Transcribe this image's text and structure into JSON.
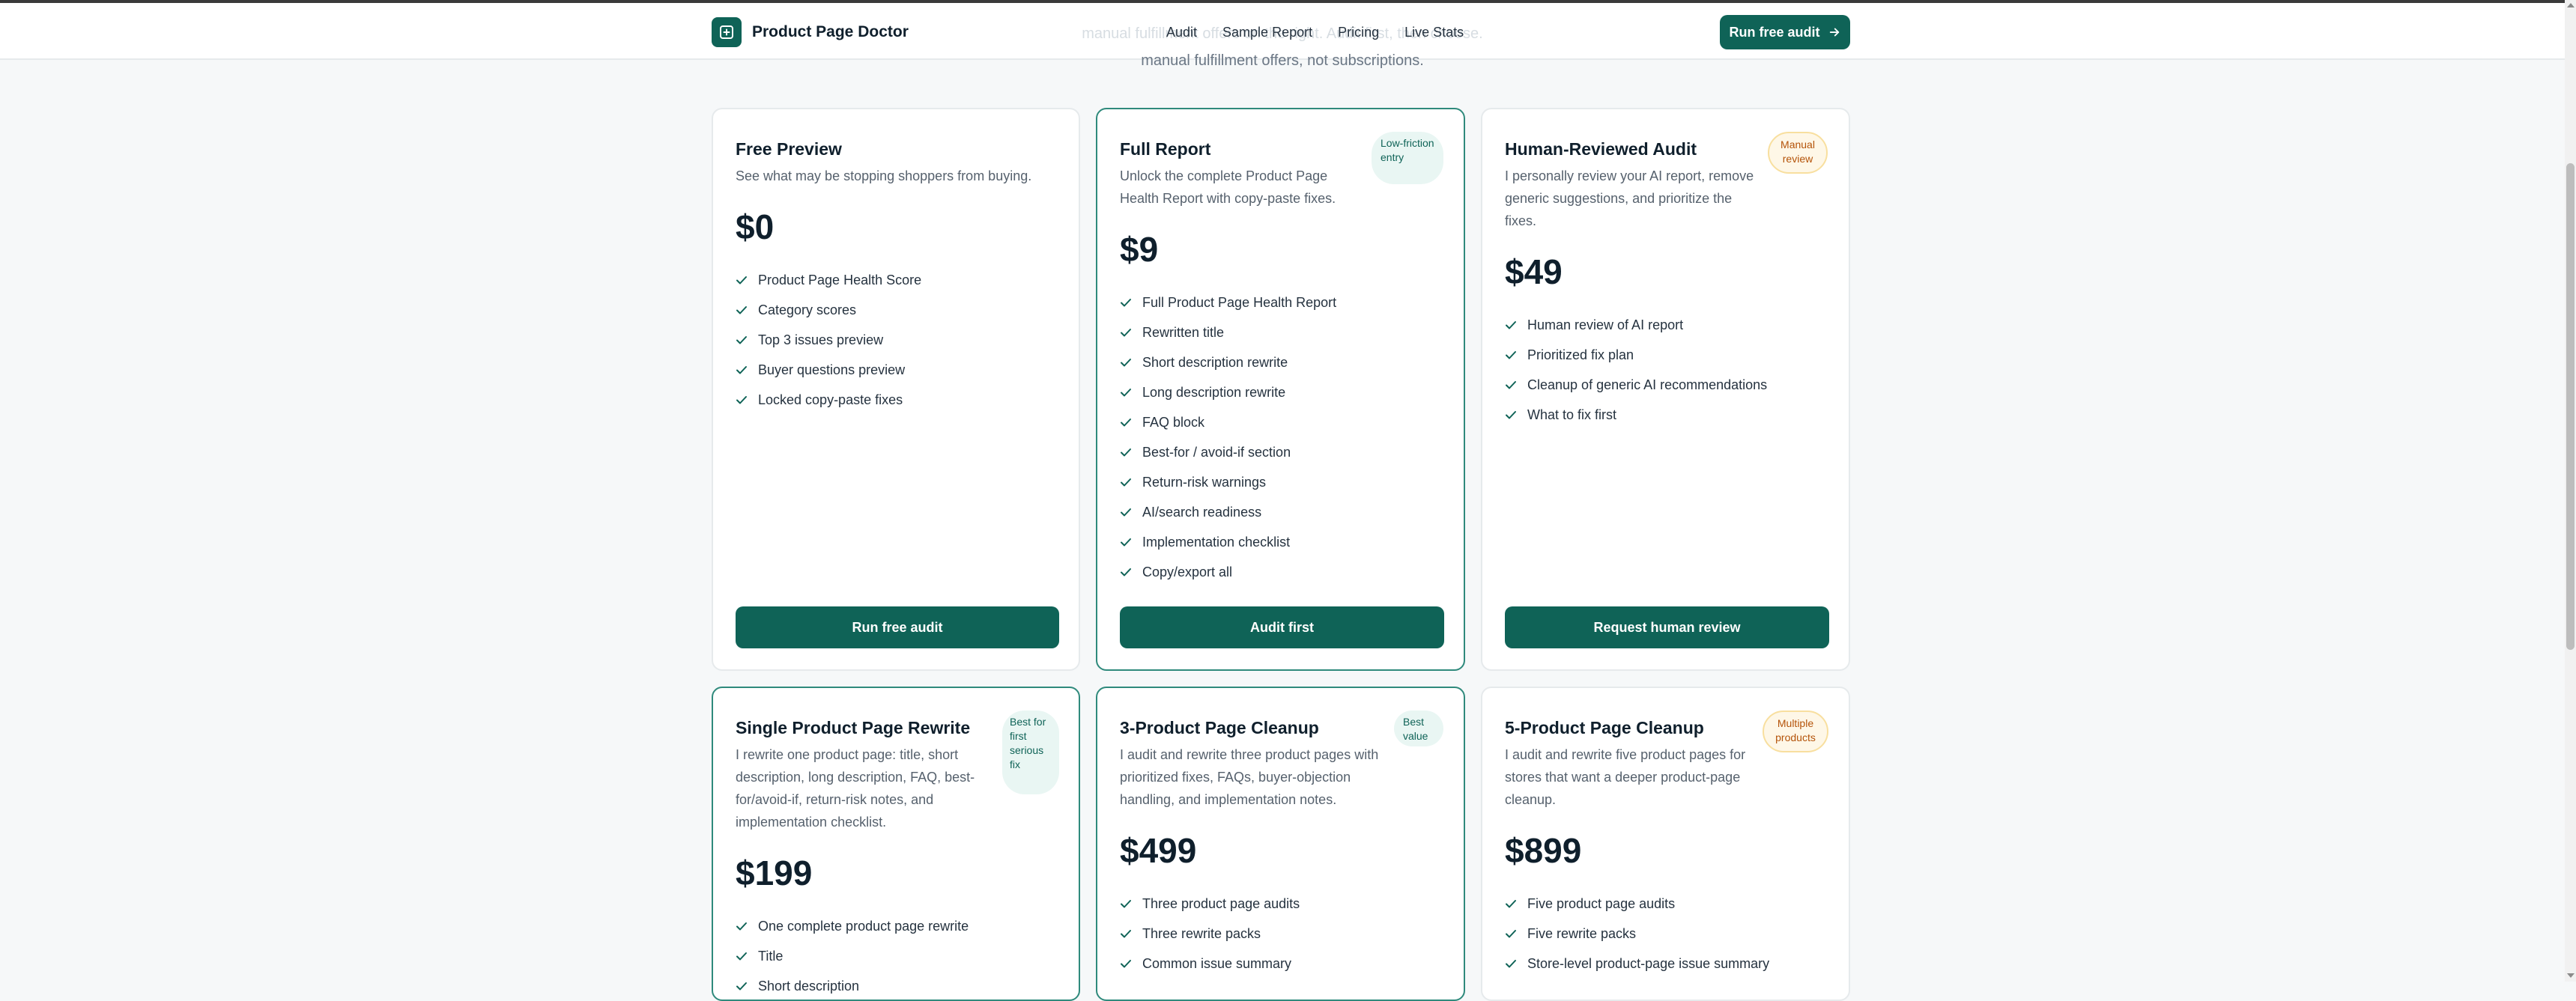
{
  "hero": {
    "ghost_line": "manual fulfillment offers on the right. Audit first, then choose.",
    "subtitle_tail": "manual fulfillment offers, not subscriptions."
  },
  "header": {
    "brand": "Product Page Doctor",
    "logo_icon": "plus-square-icon",
    "nav": [
      "Audit",
      "Sample Report",
      "Pricing",
      "Live Stats"
    ],
    "cta_label": "Run free audit",
    "cta_icon": "arrow-right-icon"
  },
  "colors": {
    "brand": "#0f6357",
    "featured_border": "#2f8a7c",
    "check": "#0f6357",
    "badge_amber": "#b45309"
  },
  "plans": [
    {
      "title": "Free Preview",
      "description": "See what may be stopping shoppers from buying.",
      "price": "$0",
      "features": [
        "Product Page Health Score",
        "Category scores",
        "Top 3 issues preview",
        "Buyer questions preview",
        "Locked copy-paste fixes"
      ],
      "button": "Run free audit"
    },
    {
      "title": "Full Report",
      "badge": "Low-friction entry",
      "description": "Unlock the complete Product Page Health Report with copy-paste fixes.",
      "price": "$9",
      "features": [
        "Full Product Page Health Report",
        "Rewritten title",
        "Short description rewrite",
        "Long description rewrite",
        "FAQ block",
        "Best-for / avoid-if section",
        "Return-risk warnings",
        "AI/search readiness",
        "Implementation checklist",
        "Copy/export all"
      ],
      "button": "Audit first"
    },
    {
      "title": "Human-Reviewed Audit",
      "badge": "Manual review",
      "description": "I personally review your AI report, remove generic suggestions, and prioritize the fixes.",
      "price": "$49",
      "features": [
        "Human review of AI report",
        "Prioritized fix plan",
        "Cleanup of generic AI recommendations",
        "What to fix first"
      ],
      "button": "Request human review"
    },
    {
      "title": "Single Product Page Rewrite",
      "badge": "Best for first serious fix",
      "description": "I rewrite one product page: title, short description, long description, FAQ, best-for/avoid-if, return-risk notes, and implementation checklist.",
      "price": "$199",
      "features": [
        "One complete product page rewrite",
        "Title",
        "Short description"
      ]
    },
    {
      "title": "3-Product Page Cleanup",
      "badge": "Best value",
      "description": "I audit and rewrite three product pages with prioritized fixes, FAQs, buyer-objection handling, and implementation notes.",
      "price": "$499",
      "features": [
        "Three product page audits",
        "Three rewrite packs",
        "Common issue summary"
      ]
    },
    {
      "title": "5-Product Page Cleanup",
      "badge": "Multiple products",
      "description": "I audit and rewrite five product pages for stores that want a deeper product-page cleanup.",
      "price": "$899",
      "features": [
        "Five product page audits",
        "Five rewrite packs",
        "Store-level product-page issue summary"
      ]
    }
  ]
}
